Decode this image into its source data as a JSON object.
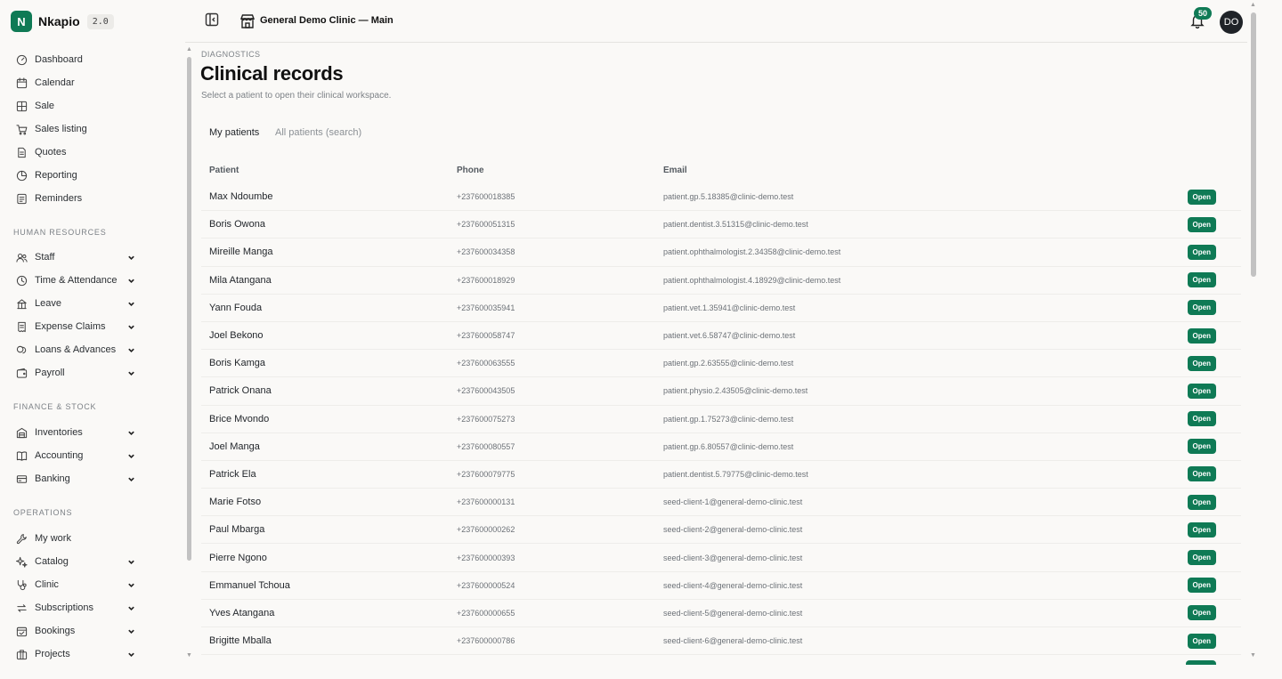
{
  "brand": {
    "logo_letter": "N",
    "name": "Nkapio",
    "version": "2.0"
  },
  "header": {
    "clinic": "General Demo Clinic — Main",
    "notifications": "50",
    "avatar": "DO"
  },
  "sidebar": {
    "main": [
      {
        "label": "Dashboard",
        "icon": "dashboard-icon"
      },
      {
        "label": "Calendar",
        "icon": "calendar-icon"
      },
      {
        "label": "Sale",
        "icon": "sale-icon"
      },
      {
        "label": "Sales listing",
        "icon": "cart-icon"
      },
      {
        "label": "Quotes",
        "icon": "document-icon"
      },
      {
        "label": "Reporting",
        "icon": "pie-chart-icon"
      },
      {
        "label": "Reminders",
        "icon": "reminder-icon"
      }
    ],
    "hr_title": "HUMAN RESOURCES",
    "hr": [
      {
        "label": "Staff",
        "icon": "users-icon"
      },
      {
        "label": "Time & Attendance",
        "icon": "clock-icon"
      },
      {
        "label": "Leave",
        "icon": "leave-icon"
      },
      {
        "label": "Expense Claims",
        "icon": "receipt-icon"
      },
      {
        "label": "Loans & Advances",
        "icon": "coins-icon"
      },
      {
        "label": "Payroll",
        "icon": "wallet-icon"
      }
    ],
    "fin_title": "FINANCE & STOCK",
    "fin": [
      {
        "label": "Inventories",
        "icon": "warehouse-icon"
      },
      {
        "label": "Accounting",
        "icon": "book-icon"
      },
      {
        "label": "Banking",
        "icon": "bank-card-icon"
      }
    ],
    "ops_title": "OPERATIONS",
    "ops": [
      {
        "label": "My work",
        "icon": "wrench-icon"
      },
      {
        "label": "Catalog",
        "icon": "sparkles-icon"
      },
      {
        "label": "Clinic",
        "icon": "stethoscope-icon"
      },
      {
        "label": "Subscriptions",
        "icon": "repeat-icon"
      },
      {
        "label": "Bookings",
        "icon": "calendar-check-icon"
      },
      {
        "label": "Projects",
        "icon": "briefcase-icon"
      }
    ]
  },
  "page": {
    "breadcrumb": "DIAGNOSTICS",
    "title": "Clinical records",
    "subtitle": "Select a patient to open their clinical workspace.",
    "tabs": [
      "My patients",
      "All patients (search)"
    ]
  },
  "table": {
    "columns": [
      "Patient",
      "Phone",
      "Email"
    ],
    "action_label": "Open",
    "rows": [
      {
        "name": "Max Ndoumbe",
        "phone": "+237600018385",
        "email": "patient.gp.5.18385@clinic-demo.test"
      },
      {
        "name": "Boris Owona",
        "phone": "+237600051315",
        "email": "patient.dentist.3.51315@clinic-demo.test"
      },
      {
        "name": "Mireille Manga",
        "phone": "+237600034358",
        "email": "patient.ophthalmologist.2.34358@clinic-demo.test"
      },
      {
        "name": "Mila Atangana",
        "phone": "+237600018929",
        "email": "patient.ophthalmologist.4.18929@clinic-demo.test"
      },
      {
        "name": "Yann Fouda",
        "phone": "+237600035941",
        "email": "patient.vet.1.35941@clinic-demo.test"
      },
      {
        "name": "Joel Bekono",
        "phone": "+237600058747",
        "email": "patient.vet.6.58747@clinic-demo.test"
      },
      {
        "name": "Boris Kamga",
        "phone": "+237600063555",
        "email": "patient.gp.2.63555@clinic-demo.test"
      },
      {
        "name": "Patrick Onana",
        "phone": "+237600043505",
        "email": "patient.physio.2.43505@clinic-demo.test"
      },
      {
        "name": "Brice Mvondo",
        "phone": "+237600075273",
        "email": "patient.gp.1.75273@clinic-demo.test"
      },
      {
        "name": "Joel Manga",
        "phone": "+237600080557",
        "email": "patient.gp.6.80557@clinic-demo.test"
      },
      {
        "name": "Patrick Ela",
        "phone": "+237600079775",
        "email": "patient.dentist.5.79775@clinic-demo.test"
      },
      {
        "name": "Marie Fotso",
        "phone": "+237600000131",
        "email": "seed-client-1@general-demo-clinic.test"
      },
      {
        "name": "Paul Mbarga",
        "phone": "+237600000262",
        "email": "seed-client-2@general-demo-clinic.test"
      },
      {
        "name": "Pierre Ngono",
        "phone": "+237600000393",
        "email": "seed-client-3@general-demo-clinic.test"
      },
      {
        "name": "Emmanuel Tchoua",
        "phone": "+237600000524",
        "email": "seed-client-4@general-demo-clinic.test"
      },
      {
        "name": "Yves Atangana",
        "phone": "+237600000655",
        "email": "seed-client-5@general-demo-clinic.test"
      },
      {
        "name": "Brigitte Mballa",
        "phone": "+237600000786",
        "email": "seed-client-6@general-demo-clinic.test"
      }
    ]
  },
  "colors": {
    "accent": "#0f7a55",
    "background": "#faf9f7",
    "text": "#1f2328",
    "muted": "#7d8287"
  }
}
